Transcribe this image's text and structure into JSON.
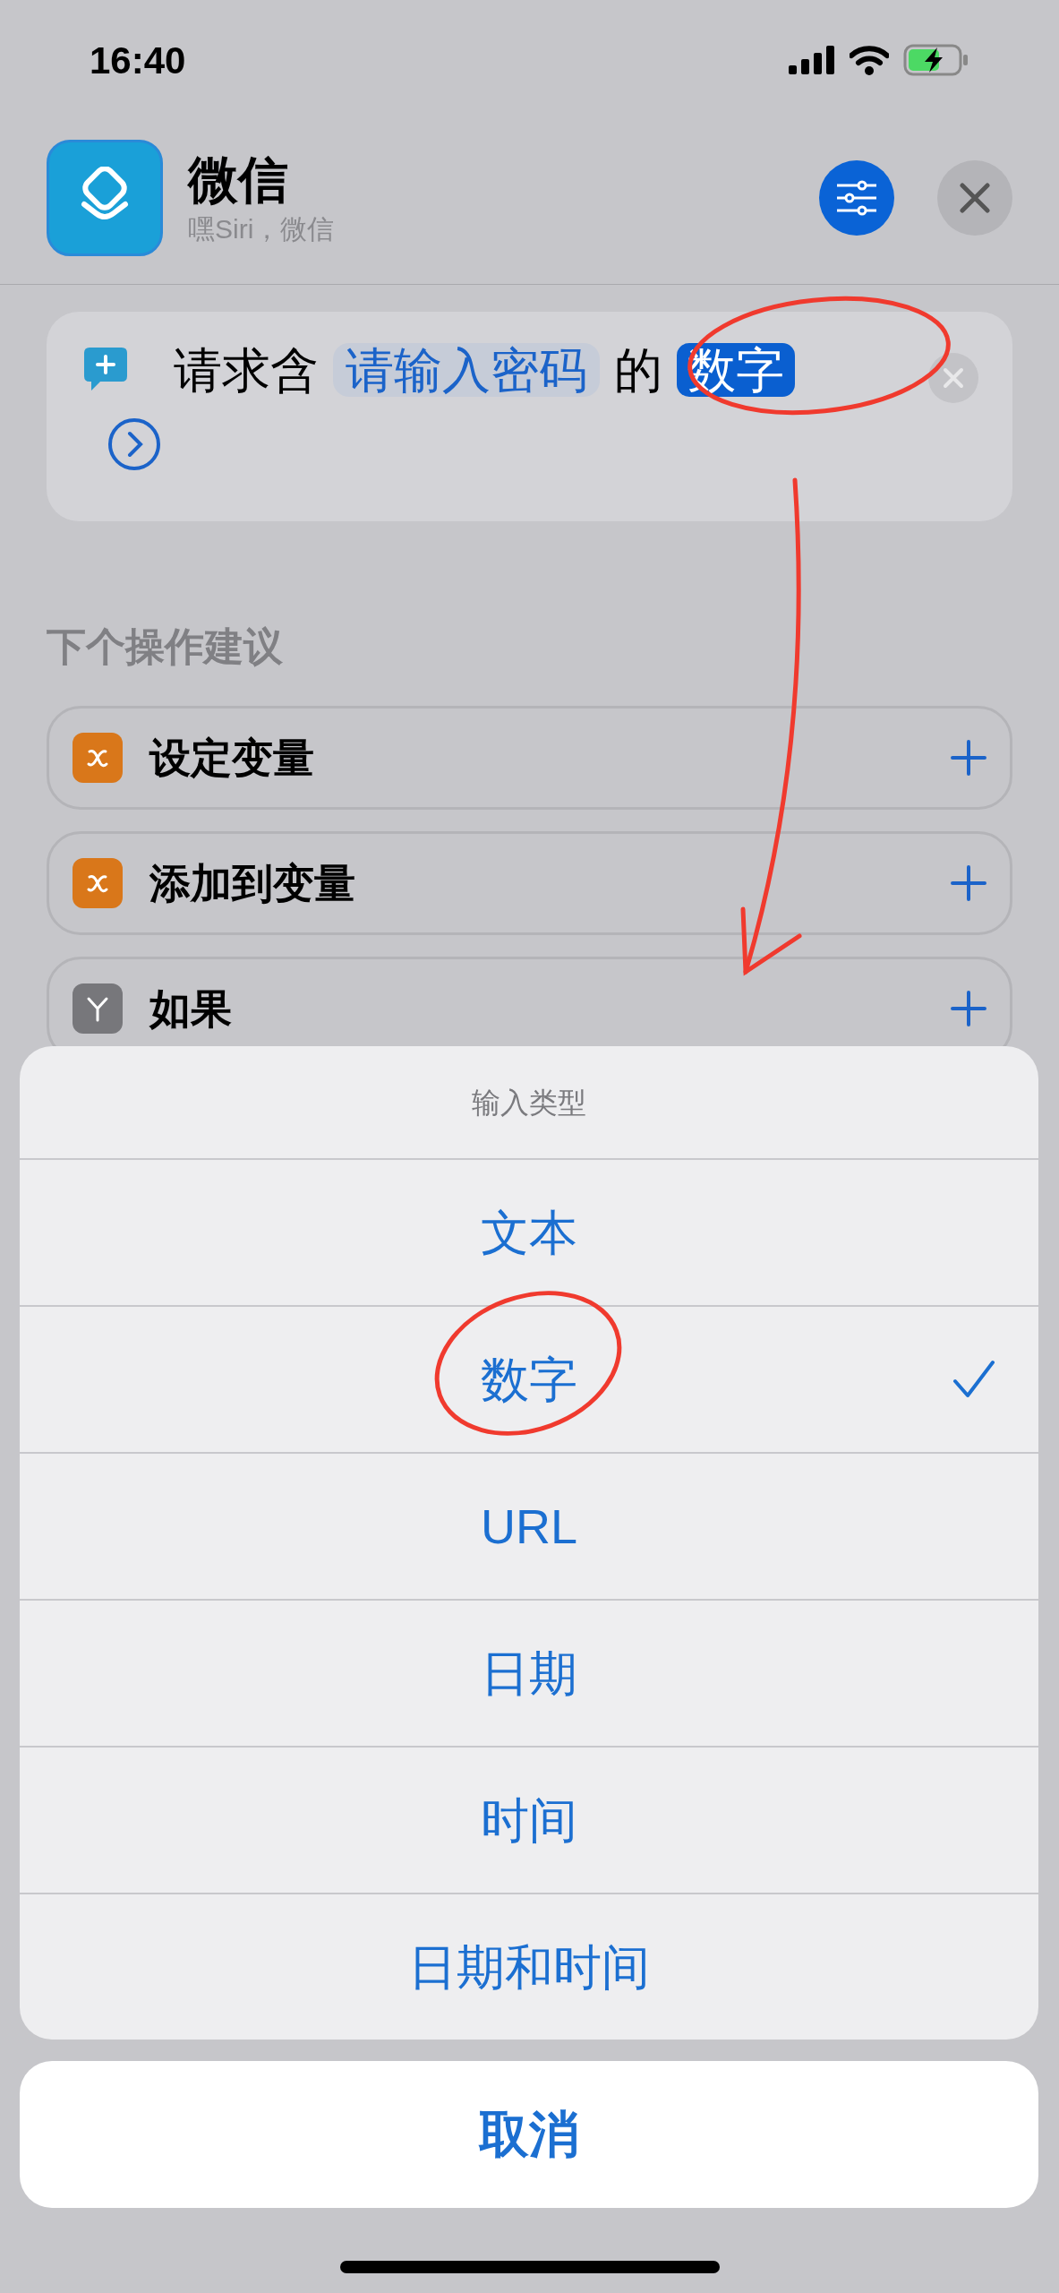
{
  "status_bar": {
    "time": "16:40"
  },
  "header": {
    "title": "微信",
    "subtitle": "嘿Siri，微信"
  },
  "action": {
    "parts": [
      {
        "kind": "text",
        "text": "请求含"
      },
      {
        "kind": "token",
        "text": "请输入密码"
      },
      {
        "kind": "text",
        "text": "的"
      },
      {
        "kind": "variable",
        "text": "数字"
      }
    ]
  },
  "suggestions": {
    "title": "下个操作建议",
    "items": [
      {
        "kind": "variable",
        "label": "设定变量"
      },
      {
        "kind": "variable",
        "label": "添加到变量"
      },
      {
        "kind": "condition",
        "label": "如果"
      }
    ]
  },
  "sheet": {
    "title": "输入类型",
    "options": [
      {
        "label": "文本",
        "selected": false
      },
      {
        "label": "数字",
        "selected": true
      },
      {
        "label": "URL",
        "selected": false
      },
      {
        "label": "日期",
        "selected": false
      },
      {
        "label": "时间",
        "selected": false
      },
      {
        "label": "日期和时间",
        "selected": false
      }
    ],
    "cancel": "取消"
  }
}
